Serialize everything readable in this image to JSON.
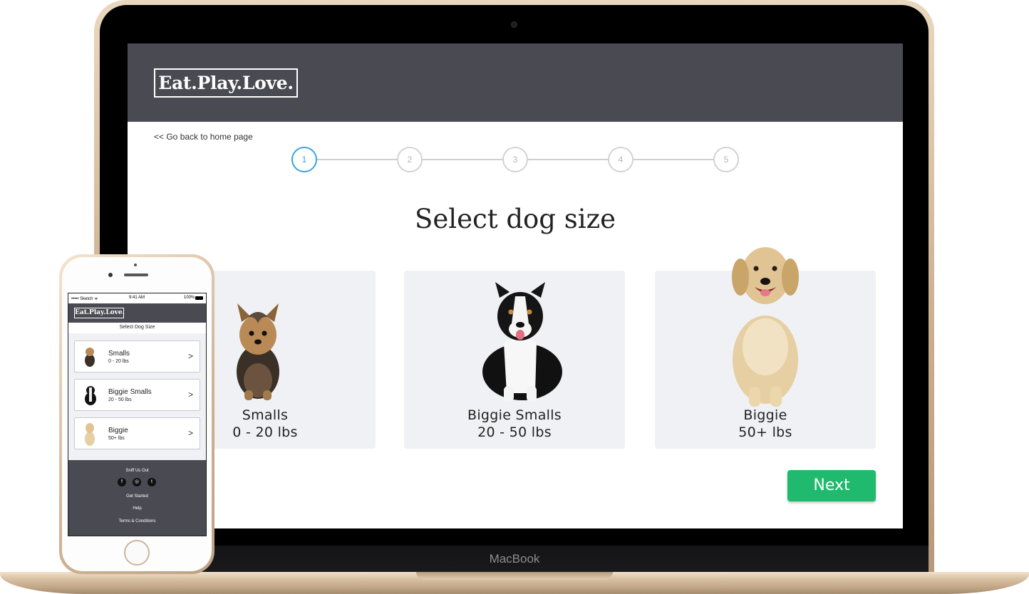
{
  "device_labels": {
    "laptop": "MacBook"
  },
  "laptop_site": {
    "logo": "Eat.Play.Love.",
    "back_link": "<< Go back to home page",
    "steps": [
      "1",
      "2",
      "3",
      "4",
      "5"
    ],
    "active_step": 1,
    "heading": "Select dog size",
    "cards": [
      {
        "name": "Smalls",
        "range": "0 - 20 lbs"
      },
      {
        "name": "Biggie Smalls",
        "range": "20 - 50 lbs"
      },
      {
        "name": "Biggie",
        "range": "50+ lbs"
      }
    ],
    "next_label": "Next"
  },
  "phone_site": {
    "status": {
      "carrier": "••••• Sketch ᯤ",
      "time": "9:41 AM",
      "battery": "100%"
    },
    "logo": "Eat.Play.Love.",
    "title": "Select Dog Size",
    "items": [
      {
        "name": "Smalls",
        "range": "0 - 20 lbs",
        "chevron": ">"
      },
      {
        "name": "Biggie Smalls",
        "range": "20 - 50 lbs",
        "chevron": ">"
      },
      {
        "name": "Biggie",
        "range": "50+ lbs",
        "chevron": ">"
      }
    ],
    "footer": {
      "heading": "Sniff Us Out",
      "social": [
        "f",
        "◎",
        "t"
      ],
      "links": [
        "Get Started",
        "Help",
        "Terms & Conditions"
      ]
    }
  },
  "colors": {
    "header_bg": "#4a4a52",
    "accent_blue": "#3aa3dd",
    "next_green": "#1fba6e",
    "card_bg": "#f0f1f5",
    "paw_yellow": "#f2c12e"
  }
}
